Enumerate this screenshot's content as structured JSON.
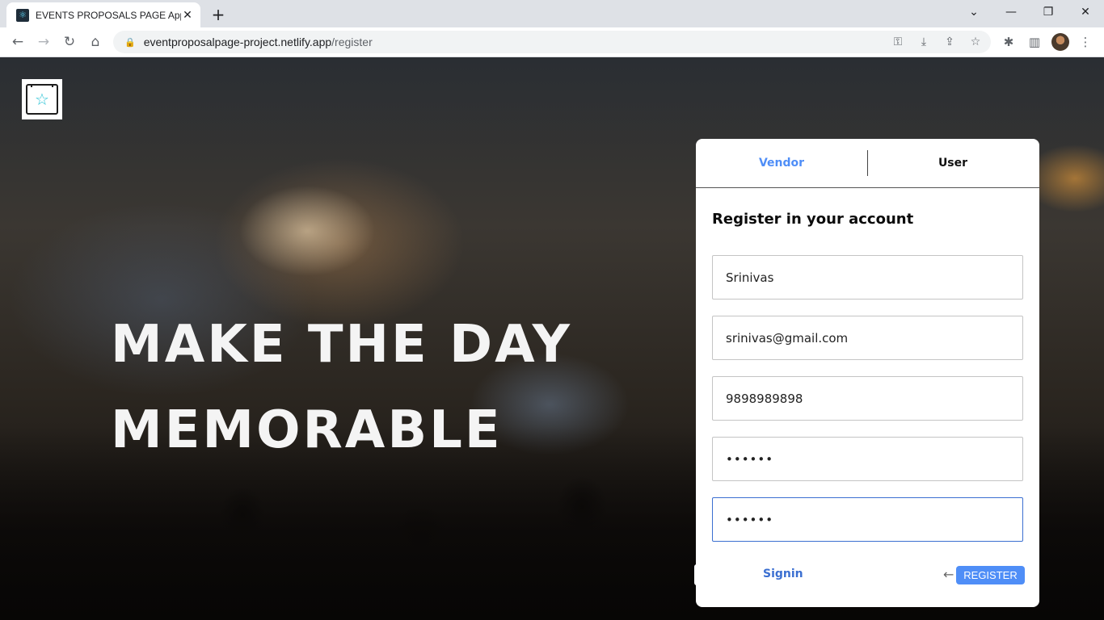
{
  "browser": {
    "tab_title": "EVENTS PROPOSALS PAGE App",
    "tab_close": "✕",
    "new_tab": "+",
    "url_host": "eventproposalpage-project.netlify.app",
    "url_path": "/register",
    "icons": {
      "back": "←",
      "forward": "→",
      "reload": "↻",
      "home": "⌂",
      "key": "⚿",
      "install": "⤓",
      "share": "⇪",
      "bookmark": "☆",
      "extensions": "✱",
      "sidepanel": "▥",
      "menu": "⋮",
      "minimize": "—",
      "restore": "❐",
      "close": "✕",
      "chevron": "⌄",
      "lock": "🔒"
    }
  },
  "hero": {
    "line1": "MAKE THE DAY",
    "line2": "MEMORABLE"
  },
  "logo": {
    "star": "☆"
  },
  "card": {
    "tabs": {
      "vendor": "Vendor",
      "user": "User"
    },
    "title": "Register in your account",
    "fields": {
      "name": "Srinivas",
      "email": "srinivas@gmail.com",
      "phone": "9898989898",
      "password": "••••••",
      "confirm_password": "••••••"
    },
    "signin_label": "Signin",
    "arrow": "←",
    "register_label": "REGISTER"
  },
  "colors": {
    "accent": "#4f8ef7",
    "link": "#3b6fd1"
  }
}
